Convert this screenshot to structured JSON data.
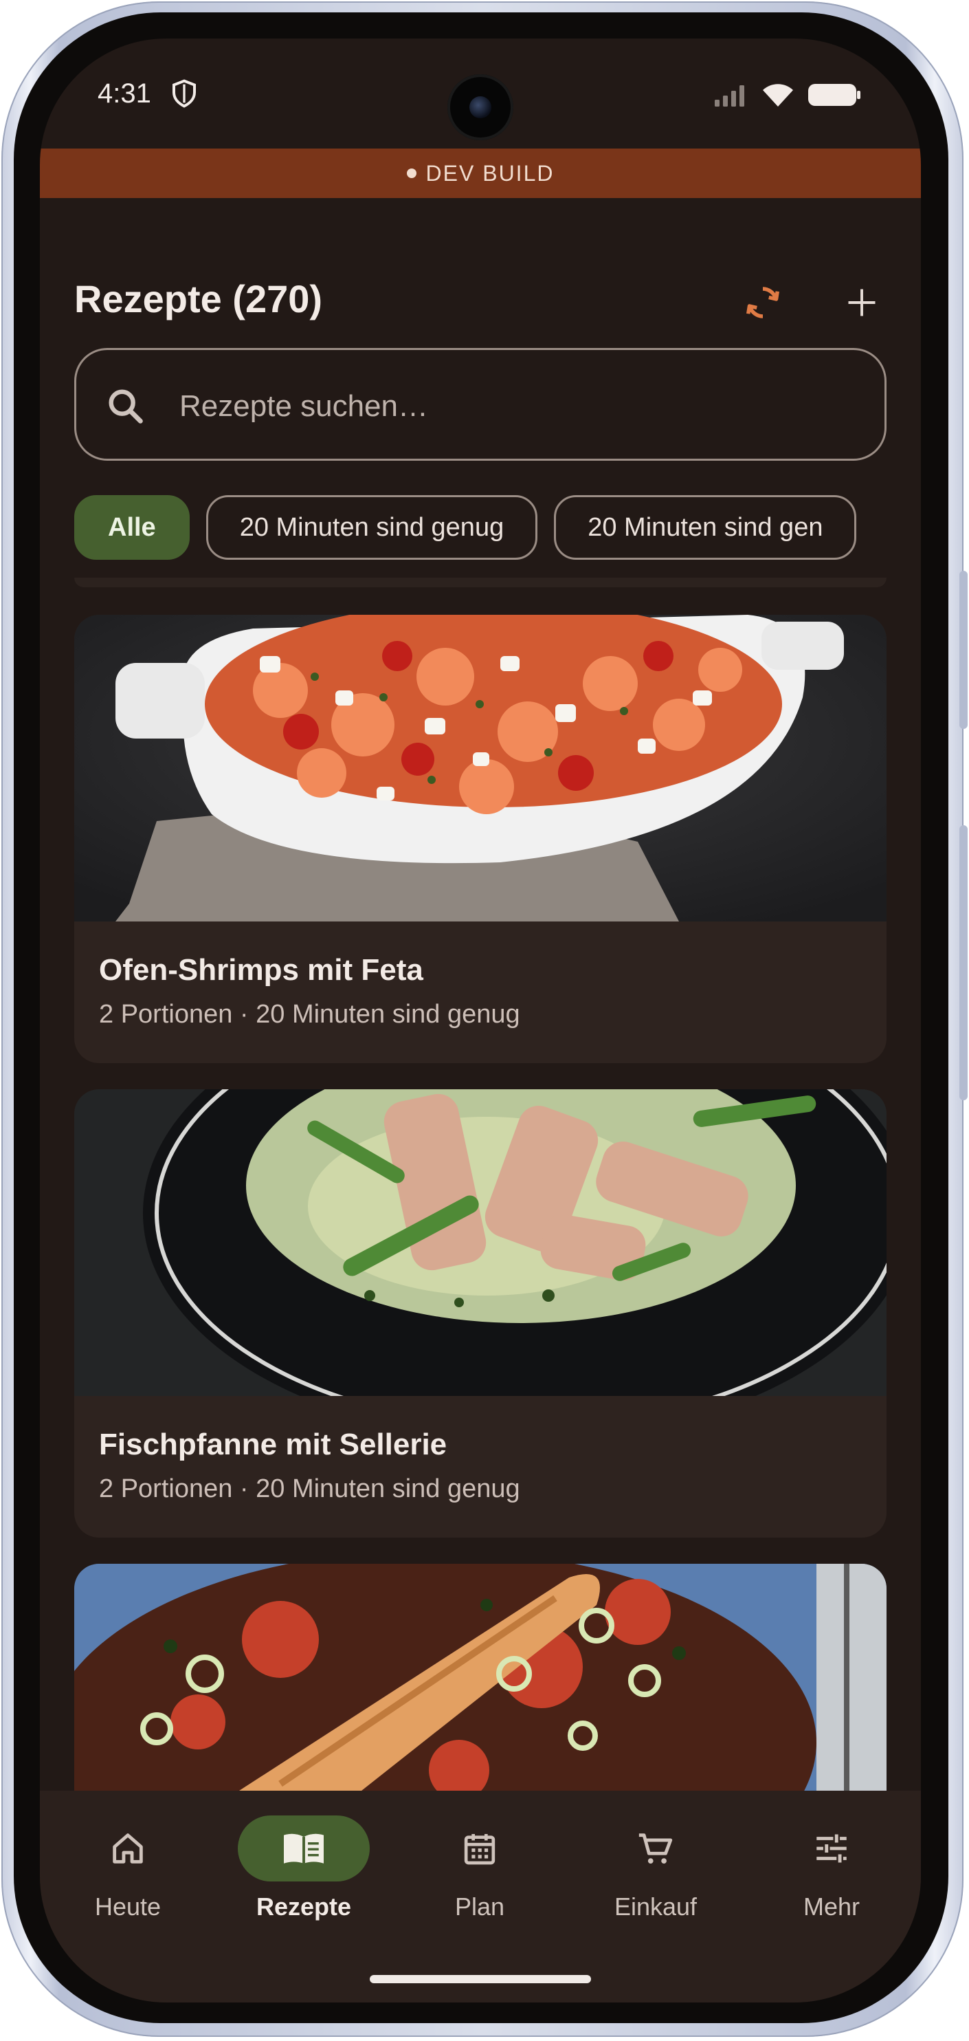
{
  "status_bar": {
    "time": "4:31"
  },
  "dev_banner": {
    "label": "DEV BUILD"
  },
  "header": {
    "title": "Rezepte (270)"
  },
  "search": {
    "placeholder": "Rezepte suchen…"
  },
  "filter_chips": [
    {
      "label": "Alle",
      "selected": true
    },
    {
      "label": "20 Minuten sind genug",
      "selected": false
    },
    {
      "label": "20 Minuten sind gen",
      "selected": false
    }
  ],
  "recipes": [
    {
      "title": "Ofen-Shrimps mit Feta",
      "subtitle": "2 Portionen · 20 Minuten sind genug"
    },
    {
      "title": "Fischpfanne mit Sellerie",
      "subtitle": "2 Portionen · 20 Minuten sind genug"
    },
    {
      "title": "",
      "subtitle": ""
    }
  ],
  "bottom_nav": [
    {
      "label": "Heute",
      "icon": "home-icon",
      "active": false
    },
    {
      "label": "Rezepte",
      "icon": "book-icon",
      "active": true
    },
    {
      "label": "Plan",
      "icon": "calendar-icon",
      "active": false
    },
    {
      "label": "Einkauf",
      "icon": "cart-icon",
      "active": false
    },
    {
      "label": "Mehr",
      "icon": "tune-icon",
      "active": false
    }
  ],
  "colors": {
    "background": "#221916",
    "accent_green": "#46602f",
    "accent_orange": "#e07b45",
    "dev_banner": "#7a3519"
  }
}
